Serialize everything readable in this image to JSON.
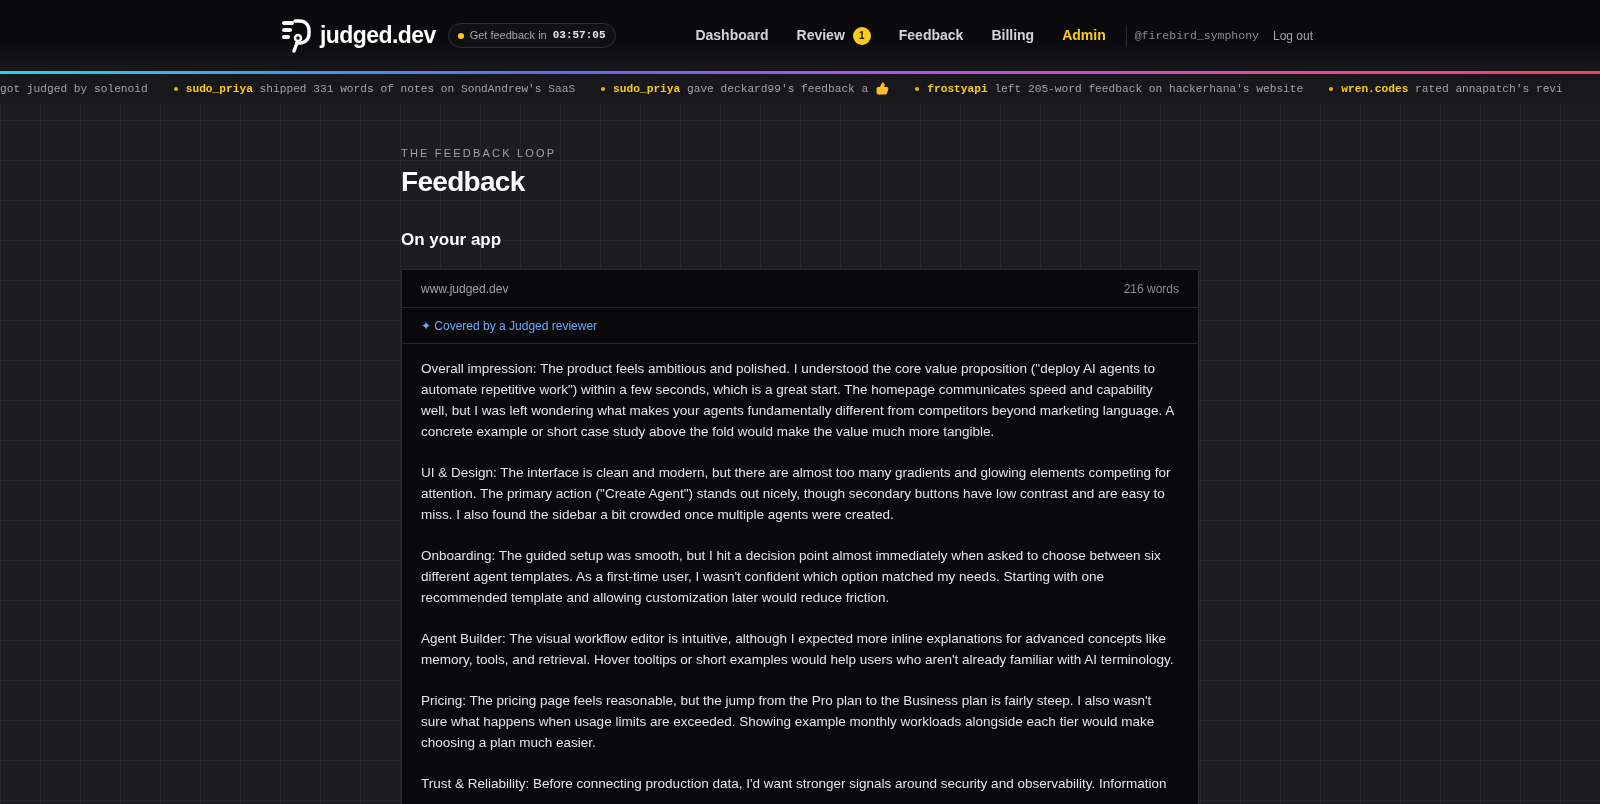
{
  "header": {
    "brand": "judged.dev",
    "timer": {
      "label": "Get feedback in",
      "value": "03:57:05"
    },
    "nav": [
      {
        "label": "Dashboard",
        "kind": "link"
      },
      {
        "label": "Review",
        "kind": "link",
        "badge": "1"
      },
      {
        "label": "Feedback",
        "kind": "link"
      },
      {
        "label": "Billing",
        "kind": "link"
      },
      {
        "label": "Admin",
        "kind": "admin"
      }
    ],
    "user": "@firebird_symphony",
    "logout": "Log out"
  },
  "ticker": [
    {
      "kind": "note",
      "text": "got judged by solenoid"
    },
    {
      "kind": "note",
      "user": "sudo_priya",
      "text": "shipped 331 words of notes on SondAndrew's SaaS"
    },
    {
      "kind": "reaction",
      "user": "sudo_priya",
      "text": "gave deckard99's feedback a"
    },
    {
      "kind": "note",
      "user": "frostyapi",
      "text": "left 205-word feedback on hackerhana's website"
    },
    {
      "kind": "note",
      "user": "wren.codes",
      "text": "rated annapatch's revi"
    }
  ],
  "page": {
    "eyebrow": "THE FEEDBACK LOOP",
    "title": "Feedback",
    "section": "On your app"
  },
  "feedback_card": {
    "site": "www.judged.dev",
    "word_count": "216 words",
    "coverage": "✦ Covered by a Judged reviewer",
    "paragraphs": [
      "Overall impression: The product feels ambitious and polished. I understood the core value proposition (\"deploy AI agents to automate repetitive work\") within a few seconds, which is a great start. The homepage communicates speed and capability well, but I was left wondering what makes your agents fundamentally different from competitors beyond marketing language. A concrete example or short case study above the fold would make the value much more tangible.",
      "UI & Design: The interface is clean and modern, but there are almost too many gradients and glowing elements competing for attention. The primary action (\"Create Agent\") stands out nicely, though secondary buttons have low contrast and are easy to miss. I also found the sidebar a bit crowded once multiple agents were created.",
      "Onboarding: The guided setup was smooth, but I hit a decision point almost immediately when asked to choose between six different agent templates. As a first-time user, I wasn't confident which option matched my needs. Starting with one recommended template and allowing customization later would reduce friction.",
      "Agent Builder: The visual workflow editor is intuitive, although I expected more inline explanations for advanced concepts like memory, tools, and retrieval. Hover tooltips or short examples would help users who aren't already familiar with AI terminology.",
      "Pricing: The pricing page feels reasonable, but the jump from the Pro plan to the Business plan is fairly steep. I also wasn't sure what happens when usage limits are exceeded. Showing example monthly workloads alongside each tier would make choosing a plan much easier.",
      "Trust & Reliability: Before connecting production data, I'd want stronger signals around security and observability. Information"
    ]
  }
}
